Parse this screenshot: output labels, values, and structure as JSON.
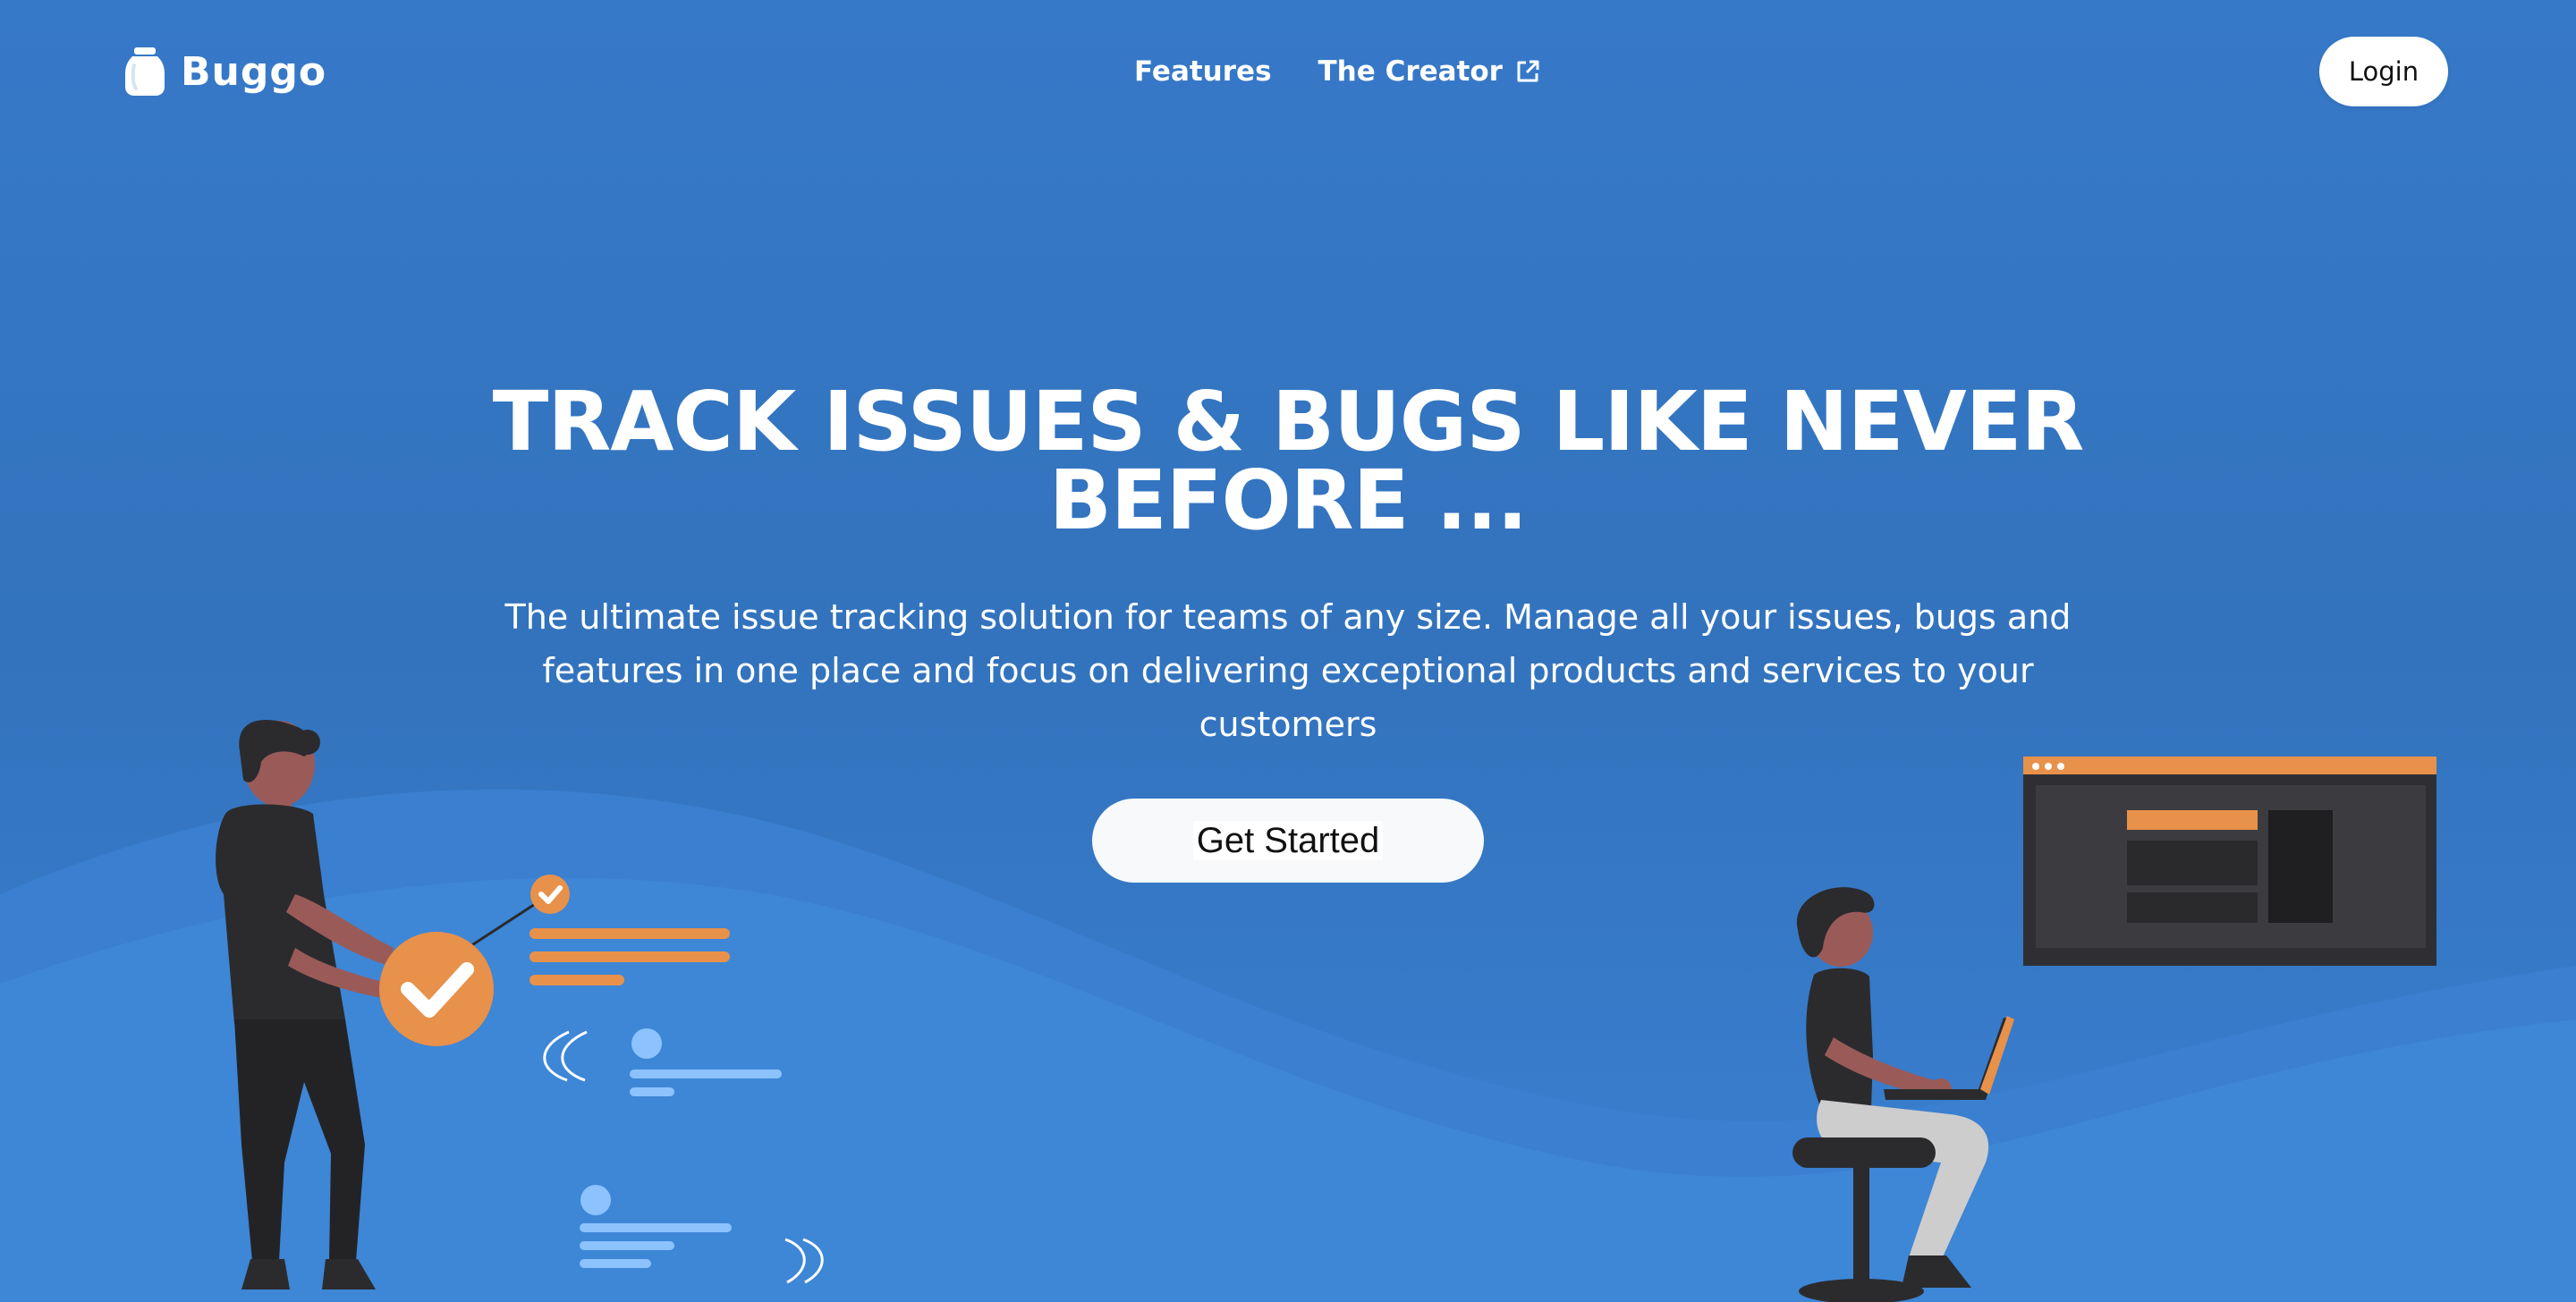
{
  "header": {
    "brand_name": "Buggo",
    "brand_icon": "jar-icon",
    "nav": {
      "features_label": "Features",
      "creator_label": "The Creator",
      "creator_icon": "external-link-icon"
    },
    "login_label": "Login"
  },
  "hero": {
    "title": "TRACK ISSUES & BUGS LIKE NEVER BEFORE ...",
    "subtitle": "The ultimate issue tracking solution for teams of any size. Manage all your issues, bugs and features in one place and focus on delivering exceptional products and services to your customers",
    "cta_label": "Get Started"
  },
  "colors": {
    "background": "#3677c6",
    "wave_light": "#3e86d6",
    "accent_orange": "#e8914a",
    "dark": "#2b2b2e",
    "skin": "#9a5b58",
    "text": "#ffffff"
  }
}
